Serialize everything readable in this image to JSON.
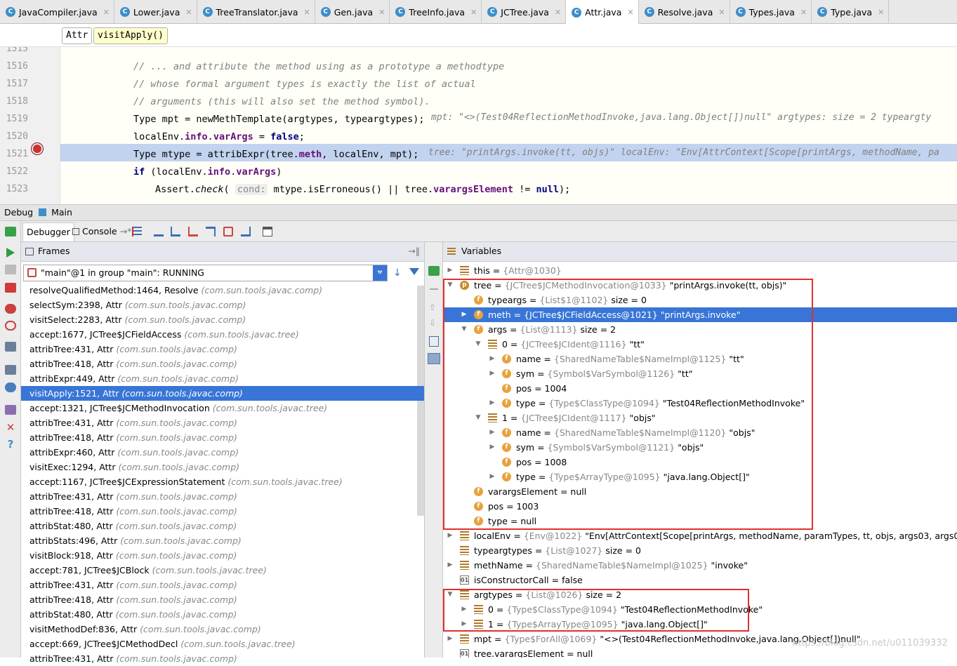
{
  "tabs": [
    {
      "label": "JavaCompiler.java",
      "icon": "C"
    },
    {
      "label": "Lower.java",
      "icon": "C"
    },
    {
      "label": "TreeTranslator.java",
      "icon": "C"
    },
    {
      "label": "Gen.java",
      "icon": "C"
    },
    {
      "label": "TreeInfo.java",
      "icon": "C"
    },
    {
      "label": "JCTree.java",
      "icon": "C"
    },
    {
      "label": "Attr.java",
      "icon": "C"
    },
    {
      "label": "Resolve.java",
      "icon": "C"
    },
    {
      "label": "Types.java",
      "icon": "C"
    },
    {
      "label": "Type.java",
      "icon": "C"
    }
  ],
  "breadcrumb": {
    "cls": "Attr",
    "method": "visitApply()"
  },
  "editor": {
    "lines": [
      {
        "num": "1515",
        "text": ""
      },
      {
        "num": "1516",
        "text": "// ... and attribute the method using as a prototype a methodtype"
      },
      {
        "num": "1517",
        "text": "// whose formal argument types is exactly the list of actual"
      },
      {
        "num": "1518",
        "text": "// arguments (this will also set the method symbol)."
      },
      {
        "num": "1519",
        "text": "Type mpt = newMethTemplate(argtypes, typeargtypes);"
      },
      {
        "num": "1520",
        "text": "localEnv.info.varArgs = false;"
      },
      {
        "num": "1521",
        "text": "Type mtype = attribExpr(tree.meth, localEnv, mpt);"
      },
      {
        "num": "1522",
        "text": "if (localEnv.info.varArgs)"
      },
      {
        "num": "1523",
        "text": "Assert.check( cond: mtype.isErroneous() || tree.varargsElement != null);"
      }
    ],
    "inline1519": "mpt: \"<>(Test04ReflectionMethodInvoke,java.lang.Object[])null\"  argtypes:  size = 2  typeargty",
    "inline1521": "tree: \"printArgs.invoke(tt, objs)\"  localEnv: \"Env[AttrContext[Scope[printArgs, methodName, pa"
  },
  "debug": {
    "title": "Debug",
    "config": "Main",
    "tab_debugger": "Debugger",
    "tab_console": "Console",
    "frames_title": "Frames",
    "variables_title": "Variables",
    "thread": "\"main\"@1 in group \"main\": RUNNING"
  },
  "frames": [
    {
      "m": "resolveQualifiedMethod:1464, Resolve",
      "p": "(com.sun.tools.javac.comp)"
    },
    {
      "m": "selectSym:2398, Attr",
      "p": "(com.sun.tools.javac.comp)"
    },
    {
      "m": "visitSelect:2283, Attr",
      "p": "(com.sun.tools.javac.comp)"
    },
    {
      "m": "accept:1677, JCTree$JCFieldAccess",
      "p": "(com.sun.tools.javac.tree)"
    },
    {
      "m": "attribTree:431, Attr",
      "p": "(com.sun.tools.javac.comp)"
    },
    {
      "m": "attribTree:418, Attr",
      "p": "(com.sun.tools.javac.comp)"
    },
    {
      "m": "attribExpr:449, Attr",
      "p": "(com.sun.tools.javac.comp)"
    },
    {
      "m": "visitApply:1521, Attr",
      "p": "(com.sun.tools.javac.comp)"
    },
    {
      "m": "accept:1321, JCTree$JCMethodInvocation",
      "p": "(com.sun.tools.javac.tree)"
    },
    {
      "m": "attribTree:431, Attr",
      "p": "(com.sun.tools.javac.comp)"
    },
    {
      "m": "attribTree:418, Attr",
      "p": "(com.sun.tools.javac.comp)"
    },
    {
      "m": "attribExpr:460, Attr",
      "p": "(com.sun.tools.javac.comp)"
    },
    {
      "m": "visitExec:1294, Attr",
      "p": "(com.sun.tools.javac.comp)"
    },
    {
      "m": "accept:1167, JCTree$JCExpressionStatement",
      "p": "(com.sun.tools.javac.tree)"
    },
    {
      "m": "attribTree:431, Attr",
      "p": "(com.sun.tools.javac.comp)"
    },
    {
      "m": "attribTree:418, Attr",
      "p": "(com.sun.tools.javac.comp)"
    },
    {
      "m": "attribStat:480, Attr",
      "p": "(com.sun.tools.javac.comp)"
    },
    {
      "m": "attribStats:496, Attr",
      "p": "(com.sun.tools.javac.comp)"
    },
    {
      "m": "visitBlock:918, Attr",
      "p": "(com.sun.tools.javac.comp)"
    },
    {
      "m": "accept:781, JCTree$JCBlock",
      "p": "(com.sun.tools.javac.tree)"
    },
    {
      "m": "attribTree:431, Attr",
      "p": "(com.sun.tools.javac.comp)"
    },
    {
      "m": "attribTree:418, Attr",
      "p": "(com.sun.tools.javac.comp)"
    },
    {
      "m": "attribStat:480, Attr",
      "p": "(com.sun.tools.javac.comp)"
    },
    {
      "m": "visitMethodDef:836, Attr",
      "p": "(com.sun.tools.javac.comp)"
    },
    {
      "m": "accept:669, JCTree$JCMethodDecl",
      "p": "(com.sun.tools.javac.tree)"
    },
    {
      "m": "attribTree:431, Attr",
      "p": "(com.sun.tools.javac.comp)"
    }
  ],
  "variables": [
    {
      "depth": 0,
      "arrow": "right",
      "icon": "lst",
      "name": "this",
      "type": "{Attr@1030}",
      "val": ""
    },
    {
      "depth": 0,
      "arrow": "down",
      "icon": "p",
      "name": "tree",
      "type": "{JCTree$JCMethodInvocation@1033}",
      "val": "\"printArgs.invoke(tt, objs)\""
    },
    {
      "depth": 1,
      "arrow": "",
      "icon": "f",
      "name": "typeargs",
      "type": "{List$1@1102}",
      "val": "size = 0"
    },
    {
      "depth": 1,
      "arrow": "right",
      "icon": "f",
      "name": "meth",
      "type": "{JCTree$JCFieldAccess@1021}",
      "val": "\"printArgs.invoke\"",
      "sel": true
    },
    {
      "depth": 1,
      "arrow": "down",
      "icon": "f",
      "name": "args",
      "type": "{List@1113}",
      "val": "size = 2"
    },
    {
      "depth": 2,
      "arrow": "down",
      "icon": "lst",
      "name": "0",
      "type": "{JCTree$JCIdent@1116}",
      "val": "\"tt\""
    },
    {
      "depth": 3,
      "arrow": "right",
      "icon": "f",
      "name": "name",
      "type": "{SharedNameTable$NameImpl@1125}",
      "val": "\"tt\""
    },
    {
      "depth": 3,
      "arrow": "right",
      "icon": "f",
      "name": "sym",
      "type": "{Symbol$VarSymbol@1126}",
      "val": "\"tt\""
    },
    {
      "depth": 3,
      "arrow": "",
      "icon": "f",
      "name": "pos",
      "type": "",
      "val": "1004"
    },
    {
      "depth": 3,
      "arrow": "right",
      "icon": "f",
      "name": "type",
      "type": "{Type$ClassType@1094}",
      "val": "\"Test04ReflectionMethodInvoke\""
    },
    {
      "depth": 2,
      "arrow": "down",
      "icon": "lst",
      "name": "1",
      "type": "{JCTree$JCIdent@1117}",
      "val": "\"objs\""
    },
    {
      "depth": 3,
      "arrow": "right",
      "icon": "f",
      "name": "name",
      "type": "{SharedNameTable$NameImpl@1120}",
      "val": "\"objs\""
    },
    {
      "depth": 3,
      "arrow": "right",
      "icon": "f",
      "name": "sym",
      "type": "{Symbol$VarSymbol@1121}",
      "val": "\"objs\""
    },
    {
      "depth": 3,
      "arrow": "",
      "icon": "f",
      "name": "pos",
      "type": "",
      "val": "1008"
    },
    {
      "depth": 3,
      "arrow": "right",
      "icon": "f",
      "name": "type",
      "type": "{Type$ArrayType@1095}",
      "val": "\"java.lang.Object[]\""
    },
    {
      "depth": 1,
      "arrow": "",
      "icon": "f",
      "name": "varargsElement",
      "type": "",
      "val": "null"
    },
    {
      "depth": 1,
      "arrow": "",
      "icon": "f",
      "name": "pos",
      "type": "",
      "val": "1003"
    },
    {
      "depth": 1,
      "arrow": "",
      "icon": "f",
      "name": "type",
      "type": "",
      "val": "null"
    },
    {
      "depth": 0,
      "arrow": "right",
      "icon": "lst",
      "name": "localEnv",
      "type": "{Env@1022}",
      "val": "\"Env[AttrContext[Scope[printArgs, methodName, paramTypes, tt, objs, args03, args02 | args | su"
    },
    {
      "depth": 0,
      "arrow": "",
      "icon": "lst",
      "name": "typeargtypes",
      "type": "{List@1027}",
      "val": "size = 0"
    },
    {
      "depth": 0,
      "arrow": "right",
      "icon": "lst",
      "name": "methName",
      "type": "{SharedNameTable$NameImpl@1025}",
      "val": "\"invoke\""
    },
    {
      "depth": 0,
      "arrow": "",
      "icon": "prim",
      "name": "isConstructorCall",
      "type": "",
      "val": "false"
    },
    {
      "depth": 0,
      "arrow": "down",
      "icon": "lst",
      "name": "argtypes",
      "type": "{List@1026}",
      "val": "size = 2"
    },
    {
      "depth": 1,
      "arrow": "right",
      "icon": "lst",
      "name": "0",
      "type": "{Type$ClassType@1094}",
      "val": "\"Test04ReflectionMethodInvoke\""
    },
    {
      "depth": 1,
      "arrow": "right",
      "icon": "lst",
      "name": "1",
      "type": "{Type$ArrayType@1095}",
      "val": "\"java.lang.Object[]\""
    },
    {
      "depth": 0,
      "arrow": "right",
      "icon": "lst",
      "name": "mpt",
      "type": "{Type$ForAll@1069}",
      "val": "\"<>(Test04ReflectionMethodInvoke,java.lang.Object[])null\""
    },
    {
      "depth": 0,
      "arrow": "",
      "icon": "prim",
      "name": "tree.varargsElement",
      "type": "",
      "val": "null"
    }
  ],
  "watermark": "https://blog.csdn.net/u011039332",
  "colors": {
    "selection": "#3875d7",
    "highlight": "#c2d3f0",
    "annotation": "#e03030"
  }
}
